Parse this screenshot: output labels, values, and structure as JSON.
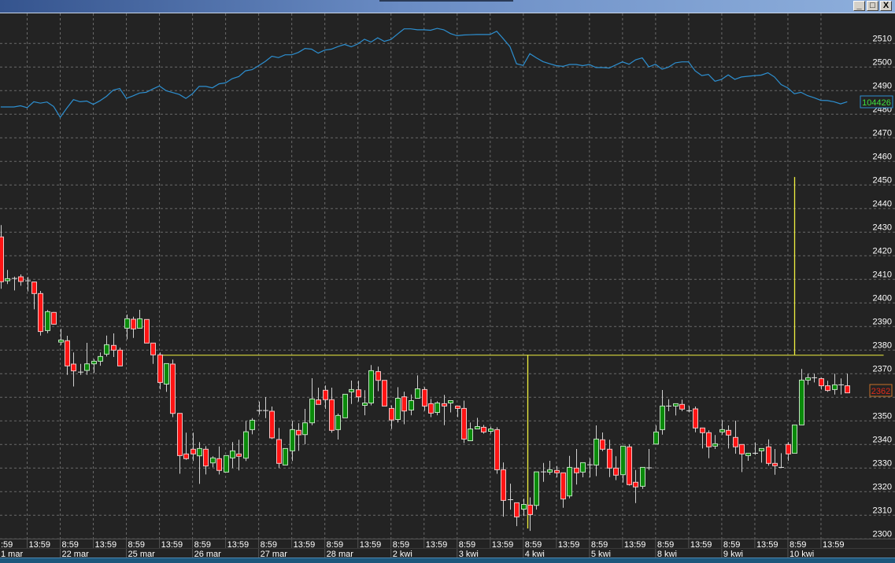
{
  "window": {
    "buttons": {
      "minimize": "_",
      "maximize": "□",
      "close": "X"
    }
  },
  "badges": {
    "indicator_value": "104426",
    "last_price": "2362",
    "indicator_color": "#2d8fd0",
    "indicator_text_color": "#3ee03e",
    "last_price_border": "#c8702a",
    "last_price_text": "#e02a1a"
  },
  "colors": {
    "background": "#232323",
    "up": "#0a8a0a",
    "down": "#ff1414",
    "wick": "#cfcfcf",
    "annotation": "#f0f040",
    "grid": "#6a6a6a"
  },
  "chart_data": {
    "type": "candlestick",
    "title": "",
    "ylabel": "",
    "ylim": [
      2300,
      2515
    ],
    "grid": true,
    "y_ticks": [
      "2300",
      "2310",
      "2320",
      "2330",
      "2340",
      "2350",
      "2360",
      "2370",
      "2380",
      "2390",
      "2400",
      "2410",
      "2420",
      "2430",
      "2440",
      "2450",
      "2460",
      "2470",
      "2480",
      "2490",
      "2500",
      "2510"
    ],
    "x_time_partial": ":59",
    "x_time_labels": [
      "13:59",
      "8:59",
      "13:59",
      "8:59",
      "13:59",
      "8:59",
      "13:59",
      "8:59",
      "13:59",
      "8:59",
      "13:59",
      "8:59",
      "13:59",
      "8:59",
      "13:59",
      "8:59",
      "13:59",
      "8:59",
      "13:59",
      "8:59",
      "13:59",
      "8:59",
      "13:59",
      "8:59",
      "13:59"
    ],
    "x_date_partial": "1 mar",
    "x_date_labels": [
      "22 mar",
      "25 mar",
      "26 mar",
      "27 mar",
      "28 mar",
      "2 kwi",
      "3 kwi",
      "4 kwi",
      "5 kwi",
      "8 kwi",
      "9 kwi",
      "10 kwi"
    ],
    "candles_ohlc": [
      [
        2428,
        2433,
        2406,
        2409
      ],
      [
        2409.4,
        2414,
        2408,
        2410.3
      ],
      [
        2410.4,
        2411.2,
        2405.3,
        2410.4
      ],
      [
        2411.1,
        2412.1,
        2407.3,
        2409.1
      ],
      [
        2409.4,
        2411,
        2404.9,
        2409.4
      ],
      [
        2408.9,
        2409,
        2397.3,
        2404
      ],
      [
        2404,
        2405.1,
        2386.2,
        2387.9
      ],
      [
        2388.3,
        2397,
        2387.2,
        2396.3
      ],
      [
        2396,
        2396.2,
        2390.8,
        2391
      ],
      [
        2383.4,
        2389,
        2382.2,
        2384.3
      ],
      [
        2384,
        2386.1,
        2369.5,
        2373.3
      ],
      [
        2374.1,
        2379,
        2364.6,
        2371.2
      ],
      [
        2370.7,
        2374.2,
        2369.5,
        2370.7
      ],
      [
        2371.4,
        2383.1,
        2369.5,
        2374.2
      ],
      [
        2374.2,
        2376.2,
        2370.4,
        2375.3
      ],
      [
        2375.3,
        2379,
        2373.4,
        2377.3
      ],
      [
        2378.3,
        2386.2,
        2377.3,
        2382.3
      ],
      [
        2382,
        2387.1,
        2377.1,
        2380
      ],
      [
        2380,
        2381,
        2373.3,
        2373.3
      ],
      [
        2389.3,
        2395.1,
        2384.6,
        2393.3
      ],
      [
        2393.1,
        2394.2,
        2385.2,
        2389
      ],
      [
        2389.3,
        2397.1,
        2389.3,
        2393.3
      ],
      [
        2393,
        2393,
        2383,
        2383
      ],
      [
        2383,
        2383,
        2374.2,
        2378
      ],
      [
        2378,
        2379,
        2363.4,
        2366.3
      ],
      [
        2365.6,
        2374.3,
        2362.3,
        2374.3
      ],
      [
        2374.1,
        2376,
        2351.6,
        2353.2
      ],
      [
        2353.2,
        2353.2,
        2327.6,
        2335.3
      ],
      [
        2336,
        2345,
        2333.5,
        2334
      ],
      [
        2338,
        2345,
        2333,
        2336
      ],
      [
        2335.2,
        2341,
        2323.3,
        2338.3
      ],
      [
        2338,
        2339.3,
        2327.3,
        2330.9
      ],
      [
        2332.2,
        2335,
        2330.3,
        2334.3
      ],
      [
        2334,
        2339.2,
        2327.3,
        2329
      ],
      [
        2328.3,
        2335.3,
        2328.3,
        2335.3
      ],
      [
        2334.3,
        2341,
        2330,
        2337.3
      ],
      [
        2336,
        2342,
        2329,
        2335
      ],
      [
        2334.2,
        2350,
        2333,
        2345.4
      ],
      [
        2346.3,
        2351.2,
        2344.3,
        2350.3
      ],
      [
        2354.4,
        2358.2,
        2352.7,
        2354.4
      ],
      [
        2354.4,
        2360.1,
        2351.2,
        2354.4
      ],
      [
        2354.1,
        2356.1,
        2342.3,
        2342.8
      ],
      [
        2342.1,
        2347,
        2330,
        2332
      ],
      [
        2331.3,
        2338.3,
        2331.3,
        2338.3
      ],
      [
        2337.3,
        2350,
        2333,
        2346.3
      ],
      [
        2346,
        2349,
        2337.3,
        2344.1
      ],
      [
        2344.2,
        2355.1,
        2340.1,
        2349.2
      ],
      [
        2349.2,
        2368.1,
        2348.2,
        2359.3
      ],
      [
        2358.9,
        2364.1,
        2357,
        2357
      ],
      [
        2363,
        2365,
        2355.1,
        2359
      ],
      [
        2359,
        2364.1,
        2345,
        2346
      ],
      [
        2346.3,
        2353.1,
        2342.1,
        2352.3
      ],
      [
        2351.3,
        2361.3,
        2351.3,
        2361.3
      ],
      [
        2362.3,
        2367.1,
        2357.2,
        2363.3
      ],
      [
        2363.2,
        2367,
        2358.2,
        2360.2
      ],
      [
        2356.6,
        2363,
        2352.4,
        2357.6
      ],
      [
        2357.6,
        2373.7,
        2356.6,
        2371.3
      ],
      [
        2370.9,
        2373,
        2362.6,
        2367.2
      ],
      [
        2367.2,
        2367.2,
        2356.3,
        2356.3
      ],
      [
        2355.3,
        2356.6,
        2346.6,
        2350.4
      ],
      [
        2350.6,
        2364.3,
        2349.3,
        2359.6
      ],
      [
        2360.2,
        2362.4,
        2348.6,
        2354.2
      ],
      [
        2354.6,
        2361.2,
        2352.4,
        2358.6
      ],
      [
        2359.6,
        2369.3,
        2359.6,
        2363.6
      ],
      [
        2363.3,
        2364.3,
        2354.3,
        2356.3
      ],
      [
        2357.3,
        2359.3,
        2351.6,
        2353.3
      ],
      [
        2353.6,
        2358.3,
        2352.4,
        2357.6
      ],
      [
        2357.3,
        2361,
        2348.2,
        2356.3
      ],
      [
        2357.6,
        2358.6,
        2353.6,
        2358.6
      ],
      [
        2356.3,
        2356.3,
        2351.6,
        2355.3
      ],
      [
        2355.3,
        2358.6,
        2340.6,
        2342.3
      ],
      [
        2341.6,
        2349.3,
        2341.6,
        2346.6
      ],
      [
        2346.6,
        2351.3,
        2346.6,
        2347.6
      ],
      [
        2347.3,
        2348.3,
        2344.6,
        2345.3
      ],
      [
        2345.6,
        2347.6,
        2344.6,
        2346.6
      ],
      [
        2346.3,
        2347.3,
        2327.6,
        2329.3
      ],
      [
        2329.3,
        2332.4,
        2309.4,
        2316.3
      ],
      [
        2316.6,
        2323.4,
        2312.4,
        2316.6
      ],
      [
        2315.3,
        2315.3,
        2305.4,
        2309.3
      ],
      [
        2312.6,
        2317,
        2309.7,
        2314.6
      ],
      [
        2314.3,
        2317.6,
        2303.4,
        2310.3
      ],
      [
        2314.2,
        2328.4,
        2312.4,
        2328.4
      ],
      [
        2328.4,
        2332.2,
        2324.2,
        2328.4
      ],
      [
        2328.3,
        2333.1,
        2327.2,
        2329.3
      ],
      [
        2329,
        2330.9,
        2326.1,
        2328
      ],
      [
        2328,
        2328,
        2313.2,
        2316.9
      ],
      [
        2318.2,
        2335.2,
        2317.2,
        2330.3
      ],
      [
        2330,
        2338.1,
        2323,
        2328
      ],
      [
        2328.3,
        2332.3,
        2326.1,
        2332.3
      ],
      [
        2331.4,
        2334.2,
        2326.1,
        2331.4
      ],
      [
        2331.3,
        2348.1,
        2326.6,
        2342.3
      ],
      [
        2342,
        2345.1,
        2337.2,
        2338
      ],
      [
        2338,
        2342,
        2326.2,
        2330
      ],
      [
        2330,
        2335,
        2324.9,
        2327
      ],
      [
        2327.2,
        2339.3,
        2323.9,
        2339.3
      ],
      [
        2339,
        2340,
        2322.6,
        2323
      ],
      [
        2324,
        2329.2,
        2315.2,
        2322
      ],
      [
        2322.3,
        2330.3,
        2321.2,
        2330.3
      ],
      [
        2330.1,
        2338.1,
        2329.2,
        2330.1
      ],
      [
        2340.2,
        2348.1,
        2340.2,
        2345.3
      ],
      [
        2346.3,
        2363.1,
        2344.2,
        2356.3
      ],
      [
        2356.3,
        2359.2,
        2354.1,
        2356.3
      ],
      [
        2356.3,
        2357.3,
        2352.3,
        2357.3
      ],
      [
        2357,
        2359,
        2354.1,
        2355
      ],
      [
        2354.3,
        2356.3,
        2353.6,
        2354.3
      ],
      [
        2355.1,
        2356.1,
        2345.2,
        2347
      ],
      [
        2347,
        2347,
        2338.3,
        2345
      ],
      [
        2345,
        2346,
        2334.2,
        2339
      ],
      [
        2339.3,
        2344,
        2338.1,
        2340.3
      ],
      [
        2345.3,
        2350.3,
        2344.2,
        2346.3
      ],
      [
        2346,
        2348.1,
        2338.3,
        2344
      ],
      [
        2343,
        2350.1,
        2336.1,
        2339
      ],
      [
        2340,
        2340,
        2328.3,
        2336
      ],
      [
        2335.3,
        2336.3,
        2333.1,
        2336.3
      ],
      [
        2336.3,
        2340.9,
        2335.6,
        2336.3
      ],
      [
        2337.3,
        2338.3,
        2332.3,
        2338.3
      ],
      [
        2339,
        2342.2,
        2331,
        2332
      ],
      [
        2332,
        2338.1,
        2327.2,
        2331
      ],
      [
        2330.3,
        2336.3,
        2330.1,
        2330.3
      ],
      [
        2340,
        2341,
        2333.1,
        2336
      ],
      [
        2336.3,
        2348.3,
        2336.3,
        2348.3
      ],
      [
        2348.3,
        2372,
        2348.3,
        2367.3
      ],
      [
        2367.3,
        2370,
        2365.3,
        2368.3
      ],
      [
        2368.3,
        2370,
        2366.3,
        2368.3
      ],
      [
        2367.9,
        2368.3,
        2363.3,
        2364.9
      ],
      [
        2364.9,
        2367,
        2362.3,
        2362.9
      ],
      [
        2363.3,
        2370,
        2361.2,
        2365.3
      ],
      [
        2365.3,
        2368,
        2361.2,
        2365.3
      ],
      [
        2364.9,
        2370,
        2361.9,
        2361.9
      ]
    ],
    "indicator_line_on_price_scale": [
      2483.1,
      2483.1,
      2483.1,
      2483.6,
      2482.8,
      2485.3,
      2484.7,
      2485.2,
      2483.3,
      2478.7,
      2482.6,
      2486.2,
      2485.3,
      2485.6,
      2484.2,
      2485.7,
      2487.6,
      2490.2,
      2490.9,
      2486.7,
      2487.8,
      2489,
      2489.3,
      2490.7,
      2492,
      2490,
      2489.2,
      2488.4,
      2486.7,
      2488.7,
      2491.8,
      2491.8,
      2491.2,
      2492.9,
      2493.3,
      2495.1,
      2496,
      2498.4,
      2498.9,
      2500.6,
      2502.4,
      2504.6,
      2504,
      2505.2,
      2505.2,
      2506.2,
      2507.9,
      2507.6,
      2505.9,
      2507.2,
      2507.6,
      2508.7,
      2509.6,
      2508.6,
      2509.8,
      2511.8,
      2510.6,
      2512.4,
      2510.9,
      2511.7,
      2514,
      2516.2,
      2516.2,
      2515.8,
      2515.8,
      2515.6,
      2516.4,
      2515.8,
      2514.2,
      2513.3,
      2513.6,
      2513.7,
      2513.8,
      2513.8,
      2513.8,
      2515.2,
      2512,
      2508.7,
      2501.4,
      2500.7,
      2505.7,
      2503.9,
      2502.3,
      2501.4,
      2500.6,
      2500.3,
      2501.1,
      2501.1,
      2500.6,
      2501.1,
      2499.8,
      2499.8,
      2499.6,
      2500.9,
      2502.2,
      2501.2,
      2503.1,
      2503.9,
      2500.1,
      2501.2,
      2499.1,
      2500,
      2501.8,
      2502.2,
      2502.2,
      2498.4,
      2496.4,
      2496.9,
      2494,
      2494.8,
      2496.7,
      2494.8,
      2495.8,
      2496.1,
      2496.4,
      2496.6,
      2497.6,
      2495.8,
      2492.6,
      2491.2,
      2488.7,
      2489.3,
      2487.9,
      2487,
      2485.9,
      2485.8,
      2485.3,
      2484.4,
      2485.3
    ],
    "annotations": [
      {
        "type": "hline",
        "price": 2378,
        "from_index": 23.7,
        "to_index": 133.5
      },
      {
        "type": "vline",
        "index": 79.6,
        "from_price": 2378,
        "to_price": 2304.4
      },
      {
        "type": "vline",
        "index": 120,
        "from_price": 2453.4,
        "to_price": 2378
      }
    ]
  }
}
